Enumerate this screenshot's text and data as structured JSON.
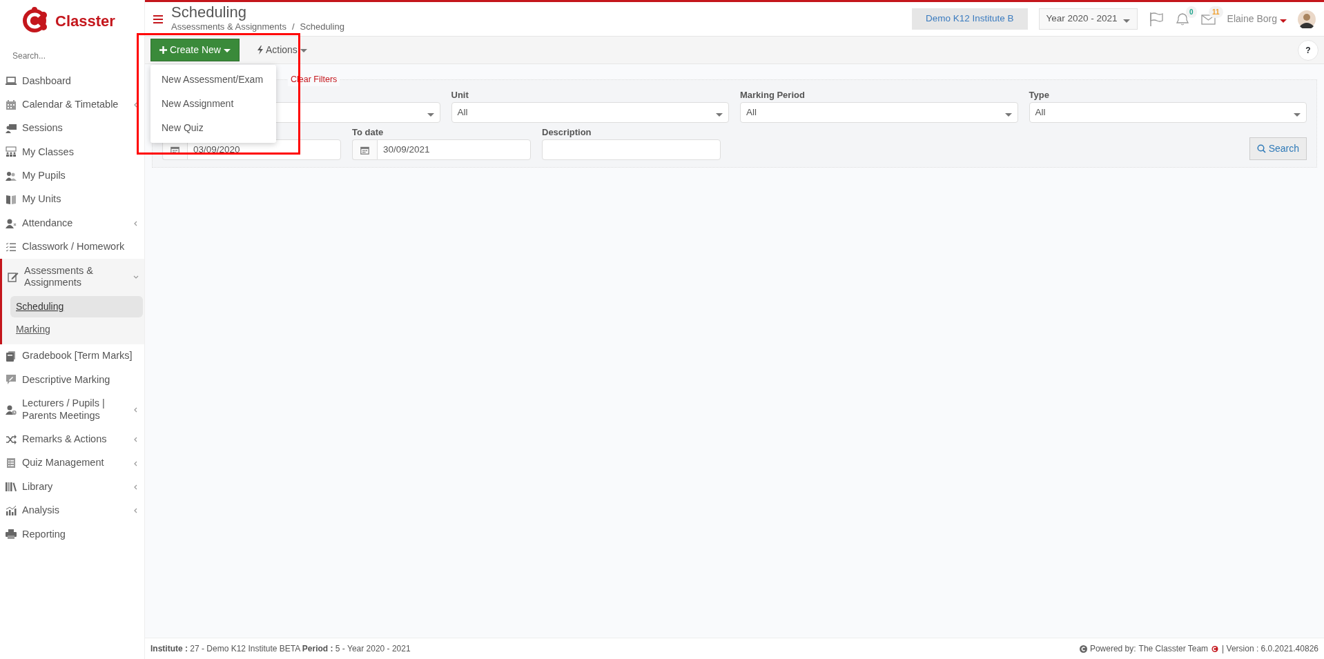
{
  "brand": {
    "name": "Classter"
  },
  "sidebar": {
    "search_placeholder": "Search...",
    "items": [
      {
        "label": "Dashboard",
        "expandable": false,
        "expanded": false
      },
      {
        "label": "Calendar & Timetable",
        "expandable": true,
        "expanded": false
      },
      {
        "label": "Sessions",
        "expandable": false,
        "expanded": false
      },
      {
        "label": "My Classes",
        "expandable": false,
        "expanded": false
      },
      {
        "label": "My Pupils",
        "expandable": false,
        "expanded": false
      },
      {
        "label": "My Units",
        "expandable": false,
        "expanded": false
      },
      {
        "label": "Attendance",
        "expandable": true,
        "expanded": false
      },
      {
        "label": "Classwork / Homework",
        "expandable": false,
        "expanded": false
      },
      {
        "label": "Assessments & Assignments",
        "expandable": true,
        "expanded": true,
        "children": [
          {
            "label": "Scheduling",
            "selected": true
          },
          {
            "label": "Marking",
            "selected": false
          }
        ]
      },
      {
        "label": "Gradebook [Term Marks]",
        "expandable": false,
        "expanded": false
      },
      {
        "label": "Descriptive Marking",
        "expandable": false,
        "expanded": false
      },
      {
        "label": "Lecturers / Pupils | Parents Meetings",
        "expandable": true,
        "expanded": false
      },
      {
        "label": "Remarks & Actions",
        "expandable": true,
        "expanded": false
      },
      {
        "label": "Quiz Management",
        "expandable": true,
        "expanded": false
      },
      {
        "label": "Library",
        "expandable": true,
        "expanded": false
      },
      {
        "label": "Analysis",
        "expandable": true,
        "expanded": false
      },
      {
        "label": "Reporting",
        "expandable": false,
        "expanded": false
      }
    ]
  },
  "header": {
    "title": "Scheduling",
    "breadcrumb": [
      "Assessments & Assignments",
      "Scheduling"
    ],
    "breadcrumb_separator": "/",
    "institute": "Demo K12 Institute B",
    "year": "Year 2020 - 2021",
    "notifications": "0",
    "messages": "11",
    "user": "Elaine Borg"
  },
  "toolbar": {
    "create": "Create New",
    "actions": "Actions",
    "help": "?",
    "menu": [
      "New Assessment/Exam",
      "New Assignment",
      "New Quiz"
    ]
  },
  "filters": {
    "clear": "Clear Filters",
    "selects": [
      {
        "label": "Unit",
        "value": "All"
      },
      {
        "label": "Marking Period",
        "value": "All"
      },
      {
        "label": "Type",
        "value": "All"
      }
    ],
    "dates": [
      {
        "value": "03/09/2020"
      },
      {
        "label": "To date",
        "value": "30/09/2021"
      }
    ],
    "description": {
      "label": "Description"
    },
    "search": "Search"
  },
  "footer": {
    "info": "**Institute :** 27 - Demo K12 Institute BETA **Period :** 5 - Year 2020 - 2021",
    "powered": "Powered by:",
    "team": "The Classter Team",
    "version": "| Version : 6.0.2021.40826"
  }
}
